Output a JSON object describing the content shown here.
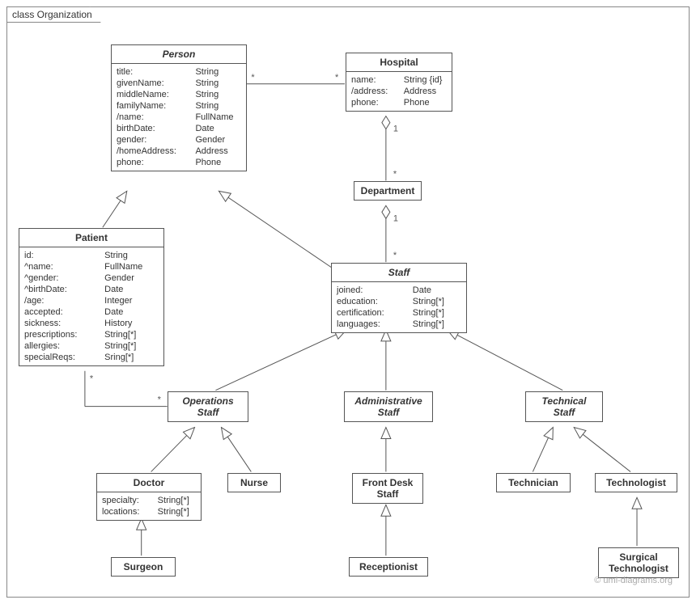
{
  "title": "class Organization",
  "watermark": "© uml-diagrams.org",
  "classes": {
    "person": {
      "name": "Person",
      "attrs": [
        [
          "title:",
          "String"
        ],
        [
          "givenName:",
          "String"
        ],
        [
          "middleName:",
          "String"
        ],
        [
          "familyName:",
          "String"
        ],
        [
          "/name:",
          "FullName"
        ],
        [
          "birthDate:",
          "Date"
        ],
        [
          "gender:",
          "Gender"
        ],
        [
          "/homeAddress:",
          "Address"
        ],
        [
          "phone:",
          "Phone"
        ]
      ]
    },
    "hospital": {
      "name": "Hospital",
      "attrs": [
        [
          "name:",
          "String {id}"
        ],
        [
          "/address:",
          "Address"
        ],
        [
          "phone:",
          "Phone"
        ]
      ]
    },
    "department": {
      "name": "Department",
      "attrs": []
    },
    "patient": {
      "name": "Patient",
      "attrs": [
        [
          "id:",
          "String"
        ],
        [
          "^name:",
          "FullName"
        ],
        [
          "^gender:",
          "Gender"
        ],
        [
          "^birthDate:",
          "Date"
        ],
        [
          "/age:",
          "Integer"
        ],
        [
          "accepted:",
          "Date"
        ],
        [
          "sickness:",
          "History"
        ],
        [
          "prescriptions:",
          "String[*]"
        ],
        [
          "allergies:",
          "String[*]"
        ],
        [
          "specialReqs:",
          "Sring[*]"
        ]
      ]
    },
    "staff": {
      "name": "Staff",
      "attrs": [
        [
          "joined:",
          "Date"
        ],
        [
          "education:",
          "String[*]"
        ],
        [
          "certification:",
          "String[*]"
        ],
        [
          "languages:",
          "String[*]"
        ]
      ]
    },
    "opsStaff": {
      "name1": "Operations",
      "name2": "Staff",
      "attrs": []
    },
    "adminStaff": {
      "name1": "Administrative",
      "name2": "Staff",
      "attrs": []
    },
    "techStaff": {
      "name1": "Technical",
      "name2": "Staff",
      "attrs": []
    },
    "doctor": {
      "name": "Doctor",
      "attrs": [
        [
          "specialty:",
          "String[*]"
        ],
        [
          "locations:",
          "String[*]"
        ]
      ]
    },
    "nurse": {
      "name": "Nurse",
      "attrs": []
    },
    "frontDesk": {
      "name1": "Front Desk",
      "name2": "Staff",
      "attrs": []
    },
    "technician": {
      "name": "Technician",
      "attrs": []
    },
    "technologist": {
      "name": "Technologist",
      "attrs": []
    },
    "surgeon": {
      "name": "Surgeon",
      "attrs": []
    },
    "receptionist": {
      "name": "Receptionist",
      "attrs": []
    },
    "surgTech": {
      "name1": "Surgical",
      "name2": "Technologist",
      "attrs": []
    }
  },
  "mults": {
    "ph_star_p": "*",
    "ph_star_h": "*",
    "hd_one": "1",
    "hd_star": "*",
    "ds_one": "1",
    "ds_star": "*",
    "po_star_p": "*",
    "po_star_o": "*"
  }
}
